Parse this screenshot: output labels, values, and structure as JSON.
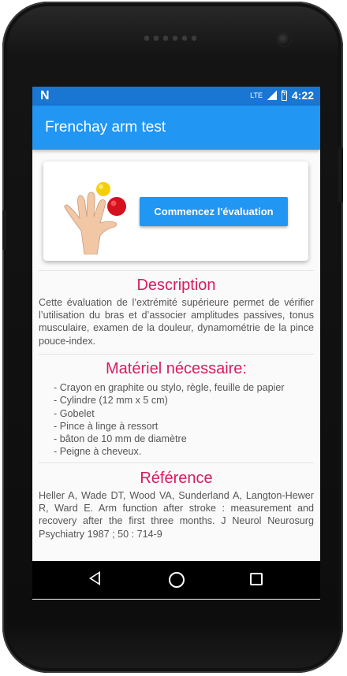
{
  "status_bar": {
    "brand_icon": "N",
    "lte_label": "LTE",
    "time": "4:22"
  },
  "app_bar": {
    "title": "Frenchay arm test"
  },
  "card": {
    "image_icon": "hand-with-balls-icon",
    "start_button_label": "Commencez l'évaluation"
  },
  "description": {
    "title": "Description",
    "text": "Cette évaluation de l’extrémité supérieure permet de vérifier l’utilisation du bras et d’associer amplitudes passives, tonus musculaire, examen de la douleur, dynamométrie de la pince pouce-index."
  },
  "material": {
    "title": "Matériel nécessaire:",
    "items": [
      "- Crayon en graphite ou stylo, règle, feuille de papier",
      "- Cylindre (12 mm x 5 cm)",
      "- Gobelet",
      "- Pince à linge à ressort",
      "- bâton de 10 mm de diamètre",
      "- Peigne à cheveux."
    ]
  },
  "reference": {
    "title": "Référence",
    "text": " Heller A, Wade DT, Wood VA, Sunderland A, Langton-Hewer R, Ward E. Arm function after stroke : measurement and recovery after the first three months. J Neurol Neurosurg Psychiatry 1987 ; 50 : 714-9"
  },
  "nav_bar": {
    "back": "back-icon",
    "home": "home-icon",
    "recent": "recent-apps-icon"
  },
  "colors": {
    "primary": "#2196f3",
    "primary_dark": "#1976d2",
    "accent_title": "#d81b60"
  }
}
